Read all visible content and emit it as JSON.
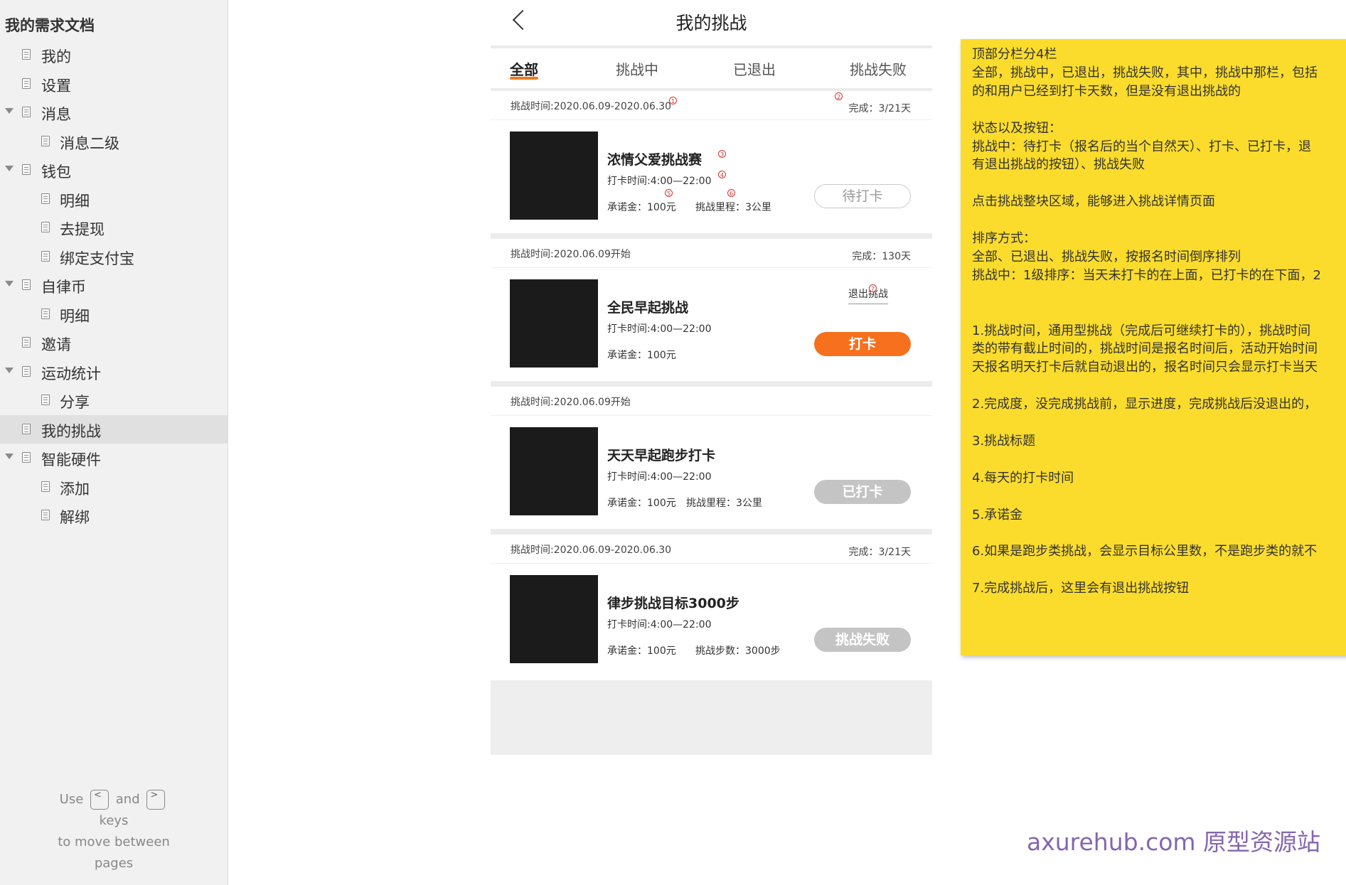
{
  "sidebar": {
    "title": "我的需求文档",
    "items": [
      {
        "label": "我的",
        "level": 1,
        "expandable": false
      },
      {
        "label": "设置",
        "level": 1,
        "expandable": false
      },
      {
        "label": "消息",
        "level": 1,
        "expandable": true
      },
      {
        "label": "消息二级",
        "level": 2,
        "expandable": false
      },
      {
        "label": "钱包",
        "level": 1,
        "expandable": true
      },
      {
        "label": "明细",
        "level": 2,
        "expandable": false
      },
      {
        "label": "去提现",
        "level": 2,
        "expandable": false
      },
      {
        "label": "绑定支付宝",
        "level": 2,
        "expandable": false
      },
      {
        "label": "自律币",
        "level": 1,
        "expandable": true
      },
      {
        "label": "明细",
        "level": 2,
        "expandable": false
      },
      {
        "label": "邀请",
        "level": 1,
        "expandable": false
      },
      {
        "label": "运动统计",
        "level": 1,
        "expandable": true
      },
      {
        "label": "分享",
        "level": 2,
        "expandable": false
      },
      {
        "label": "我的挑战",
        "level": 1,
        "expandable": false,
        "active": true
      },
      {
        "label": "智能硬件",
        "level": 1,
        "expandable": true
      },
      {
        "label": "添加",
        "level": 2,
        "expandable": false
      },
      {
        "label": "解绑",
        "level": 2,
        "expandable": false
      }
    ],
    "help": {
      "use": "Use",
      "prev_key": "<",
      "and": "and",
      "next_key": ">",
      "keys": "keys",
      "to_move": "to move between",
      "pages": "pages"
    }
  },
  "phone": {
    "title": "我的挑战",
    "tabs": [
      "全部",
      "挑战中",
      "已退出",
      "挑战失败"
    ],
    "active_tab": "全部",
    "cards": [
      {
        "time": "挑战时间:2020.06.09-2020.06.30",
        "progress": "完成：3/21天",
        "name": "浓情父爱挑战赛",
        "hours": "打卡时间:4:00—22:00",
        "deposit": "承诺金：100元",
        "extra": "挑战里程：3公里",
        "button": "待打卡",
        "button_style": "outline"
      },
      {
        "time": "挑战时间:2020.06.09开始",
        "progress": "完成：130天",
        "name": "全民早起挑战",
        "hours": "打卡时间:4:00—22:00",
        "deposit": "承诺金：100元",
        "extra": "",
        "quit": "退出挑战",
        "button": "打卡",
        "button_style": "orange"
      },
      {
        "time": "挑战时间:2020.06.09开始",
        "progress": "",
        "name": "天天早起跑步打卡",
        "hours": "打卡时间:4:00—22:00",
        "deposit": "承诺金：100元",
        "extra": "挑战里程：3公里",
        "button": "已打卡",
        "button_style": "grey"
      },
      {
        "time": "挑战时间:2020.06.09-2020.06.30",
        "progress": "完成：3/21天",
        "name": "律步挑战目标3000步",
        "hours": "打卡时间:4:00—22:00",
        "deposit": "承诺金：100元",
        "extra": "挑战步数：3000步",
        "button": "挑战失败",
        "button_style": "grey"
      }
    ],
    "markers": [
      "1",
      "2",
      "3",
      "4",
      "5",
      "6",
      "7"
    ]
  },
  "note": {
    "lines": [
      "顶部分栏分4栏",
      "全部，挑战中，已退出，挑战失败，其中，挑战中那栏，包括",
      "的和用户已经到打卡天数，但是没有退出挑战的",
      "",
      "状态以及按钮：",
      "挑战中：待打卡（报名后的当个自然天）、打卡、已打卡，退",
      "有退出挑战的按钮）、挑战失败",
      "",
      "点击挑战整块区域，能够进入挑战详情页面",
      "",
      "排序方式：",
      "全部、已退出、挑战失败，按报名时间倒序排列",
      "挑战中：1级排序：当天未打卡的在上面，已打卡的在下面，2",
      "",
      "",
      "1.挑战时间，通用型挑战（完成后可继续打卡的），挑战时间",
      "类的带有截止时间的，挑战时间是报名时间后，活动开始时间",
      "天报名明天打卡后就自动退出的，报名时间只会显示打卡当天",
      "",
      "2.完成度，没完成挑战前，显示进度，完成挑战后没退出的，",
      "",
      "3.挑战标题",
      "",
      "4.每天的打卡时间",
      "",
      "5.承诺金",
      "",
      "6.如果是跑步类挑战，会显示目标公里数，不是跑步类的就不",
      "",
      "7.完成挑战后，这里会有退出挑战按钮"
    ]
  },
  "watermark": "axurehub.com 原型资源站",
  "colors": {
    "accent": "#f7701d",
    "tab_underline": "#f07b1d",
    "note_bg": "#fbdc2c",
    "marker": "#d8322a",
    "watermark": "#8466b0"
  }
}
